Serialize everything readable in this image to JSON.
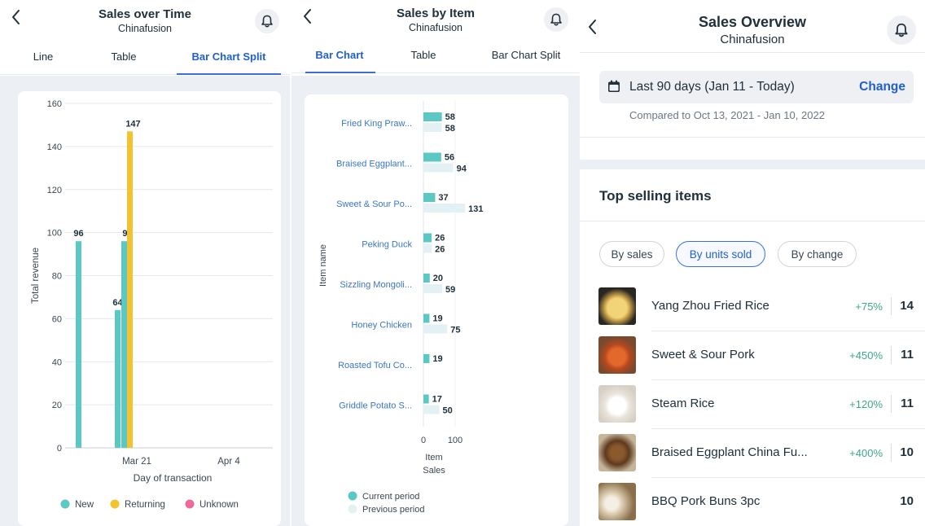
{
  "colors": {
    "accent": "#1f5fd1",
    "teal": "#5cc8c4",
    "yellow": "#f2c230",
    "pink": "#ec6b9a",
    "light_teal": "#e3f1f4",
    "positive": "#3ba88a"
  },
  "panel1": {
    "title": "Sales over Time",
    "subtitle": "Chinafusion",
    "tabs": [
      "Line",
      "Table",
      "Bar Chart Split"
    ],
    "active_tab": 2,
    "chart_data": {
      "type": "bar",
      "xlabel": "Day of transaction",
      "ylabel": "Total revenue",
      "ylim": [
        0,
        160
      ],
      "yticks": [
        "0",
        "20",
        "40",
        "60",
        "80",
        "100",
        "120",
        "140",
        "160"
      ],
      "xticks": [
        "Mar 21",
        "Apr 4"
      ],
      "series": [
        {
          "name": "New",
          "color": "#5cc8c4"
        },
        {
          "name": "Returning",
          "color": "#f2c230"
        },
        {
          "name": "Unknown",
          "color": "#ec6b9a"
        }
      ],
      "bars": [
        {
          "series": "New",
          "value": 96,
          "label": "96"
        },
        {
          "series": "New",
          "value": 64,
          "label": "64"
        },
        {
          "series": "New",
          "value": 96,
          "label": "96"
        },
        {
          "series": "Returning",
          "value": 147,
          "label": "147"
        }
      ]
    }
  },
  "panel2": {
    "title": "Sales by Item",
    "subtitle": "Chinafusion",
    "tabs": [
      "Bar Chart",
      "Table",
      "Bar Chart Split"
    ],
    "active_tab": 0,
    "chart_data": {
      "type": "bar",
      "orientation": "horizontal",
      "ylabel": "Item name",
      "xlabel": "Item Sales",
      "xticks": [
        "0",
        "100"
      ],
      "xlim": [
        0,
        100
      ],
      "categories": [
        "Fried King Praw...",
        "Braised Eggplant...",
        "Sweet & Sour Po...",
        "Peking Duck",
        "Sizzling Mongoli...",
        "Honey Chicken",
        "Roasted Tofu Co...",
        "Griddle Potato S..."
      ],
      "series": [
        {
          "name": "Current period",
          "color": "#5cc8c4",
          "values": [
            58,
            56,
            37,
            26,
            20,
            19,
            19,
            17
          ]
        },
        {
          "name": "Previous period",
          "color": "#e3f1f4",
          "values": [
            58,
            94,
            131,
            26,
            59,
            75,
            null,
            50
          ]
        }
      ]
    }
  },
  "panel3": {
    "title": "Sales Overview",
    "subtitle": "Chinafusion",
    "date_range": "Last 90 days (Jan 11 - Today)",
    "change_label": "Change",
    "compared": "Compared to Oct 13, 2021 - Jan 10, 2022",
    "section_title": "Top selling items",
    "chips": [
      "By sales",
      "By units sold",
      "By change"
    ],
    "selected_chip": 1,
    "items": [
      {
        "name": "Yang Zhou Fried Rice",
        "change": "+75%",
        "units": "14"
      },
      {
        "name": "Sweet & Sour Pork",
        "change": "+450%",
        "units": "11"
      },
      {
        "name": "Steam Rice",
        "change": "+120%",
        "units": "11"
      },
      {
        "name": "Braised Eggplant China Fu...",
        "change": "+400%",
        "units": "10"
      },
      {
        "name": "BBQ Pork Buns 3pc",
        "change": "",
        "units": "10"
      }
    ]
  }
}
